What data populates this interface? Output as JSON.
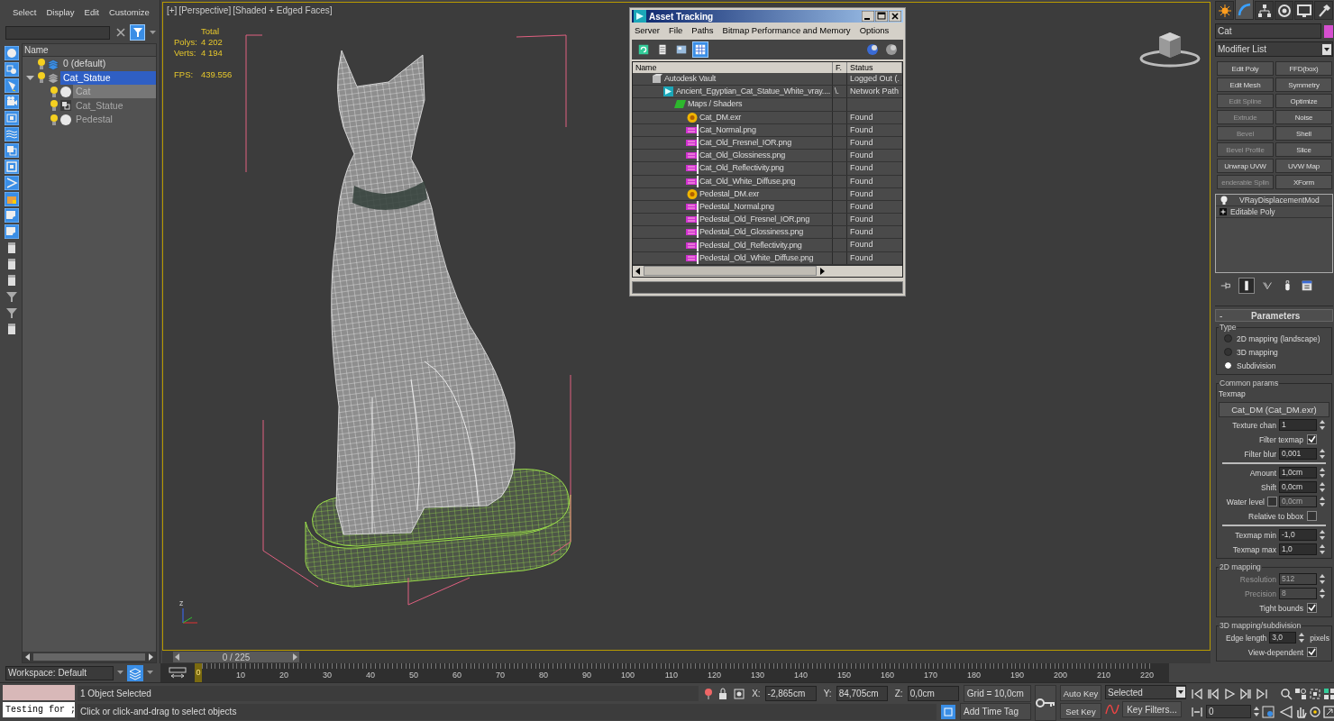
{
  "scene_explorer": {
    "menu": [
      "Select",
      "Display",
      "Edit",
      "Customize"
    ],
    "column": "Name",
    "filters": [
      {
        "kind": "sphere",
        "on": true
      },
      {
        "kind": "shapes",
        "on": true
      },
      {
        "kind": "lamp",
        "on": true
      },
      {
        "kind": "camera",
        "on": true
      },
      {
        "kind": "helper",
        "on": true
      },
      {
        "kind": "wave",
        "on": true
      },
      {
        "kind": "group",
        "on": true
      },
      {
        "kind": "frame",
        "on": true
      },
      {
        "kind": "bone",
        "on": true
      },
      {
        "kind": "container",
        "on": true
      },
      {
        "kind": "xref",
        "on": true
      },
      {
        "kind": "xref",
        "on": true
      },
      {
        "kind": "page",
        "on": false
      },
      {
        "kind": "page",
        "on": false
      },
      {
        "kind": "page",
        "on": false
      },
      {
        "kind": "funnel",
        "on": false
      },
      {
        "kind": "funnel",
        "on": false
      },
      {
        "kind": "page",
        "on": false
      }
    ],
    "tree": [
      {
        "label": "0 (default)",
        "kind": "layer",
        "current": true,
        "selected": false,
        "highlighted": false
      },
      {
        "label": "Cat_Statue",
        "kind": "layer",
        "current": false,
        "selected": true,
        "highlighted": false,
        "expanded": true,
        "children": [
          {
            "label": "Cat",
            "kind": "object",
            "selected": false,
            "highlighted": true
          },
          {
            "label": "Cat_Statue",
            "kind": "group",
            "selected": false,
            "highlighted": false
          },
          {
            "label": "Pedestal",
            "kind": "object",
            "selected": false,
            "highlighted": false
          }
        ]
      }
    ]
  },
  "workspace": "Workspace: Default",
  "viewport": {
    "labels": [
      "[+]",
      "[Perspective]",
      "[Shaded + Edged Faces]"
    ],
    "stats": {
      "header": "Total",
      "rows": [
        {
          "label": "Polys:",
          "value": "4 202"
        },
        {
          "label": "Verts:",
          "value": "4 194"
        }
      ],
      "fps_label": "FPS:",
      "fps": "439.556"
    },
    "axis_label": "z"
  },
  "timeline": {
    "slider": "0 / 225",
    "level": 0,
    "thumb": "0",
    "ticks": [
      "10",
      "20",
      "30",
      "40",
      "50",
      "60",
      "70",
      "80",
      "90",
      "100",
      "110",
      "120",
      "130",
      "140",
      "150",
      "160",
      "170",
      "180",
      "190",
      "200",
      "210",
      "220"
    ]
  },
  "asset_tracking": {
    "title": "Asset Tracking",
    "menu": [
      "Server",
      "File",
      "Paths",
      "Bitmap Performance and Memory",
      "Options"
    ],
    "tools": [
      {
        "kind": "refresh",
        "selected": false
      },
      {
        "kind": "list",
        "selected": false
      },
      {
        "kind": "thumbnails",
        "selected": false
      },
      {
        "kind": "table",
        "selected": true
      }
    ],
    "columns": [
      "Name",
      "F.",
      "Status"
    ],
    "rows": [
      {
        "name": "Autodesk Vault",
        "kind": "vault",
        "status": "Logged Out (.",
        "children": [
          {
            "name": "Ancient_Egyptian_Cat_Statue_White_vray....",
            "kind": "scene",
            "f": "\\.",
            "status": "Network Path",
            "children": [
              {
                "name": "Maps / Shaders",
                "kind": "maps",
                "children": [
                  {
                    "name": "Cat_DM.exr",
                    "kind": "exr",
                    "status": "Found"
                  },
                  {
                    "name": "Cat_Normal.png",
                    "kind": "png",
                    "status": "Found"
                  },
                  {
                    "name": "Cat_Old_Fresnel_IOR.png",
                    "kind": "png",
                    "status": "Found"
                  },
                  {
                    "name": "Cat_Old_Glossiness.png",
                    "kind": "png",
                    "status": "Found"
                  },
                  {
                    "name": "Cat_Old_Reflectivity.png",
                    "kind": "png",
                    "status": "Found"
                  },
                  {
                    "name": "Cat_Old_White_Diffuse.png",
                    "kind": "png",
                    "status": "Found"
                  },
                  {
                    "name": "Pedestal_DM.exr",
                    "kind": "exr",
                    "status": "Found"
                  },
                  {
                    "name": "Pedestal_Normal.png",
                    "kind": "png",
                    "status": "Found"
                  },
                  {
                    "name": "Pedestal_Old_Fresnel_IOR.png",
                    "kind": "png",
                    "status": "Found"
                  },
                  {
                    "name": "Pedestal_Old_Glossiness.png",
                    "kind": "png",
                    "status": "Found"
                  },
                  {
                    "name": "Pedestal_Old_Reflectivity.png",
                    "kind": "png",
                    "status": "Found"
                  },
                  {
                    "name": "Pedestal_Old_White_Diffuse.png",
                    "kind": "png",
                    "status": "Found"
                  }
                ]
              }
            ]
          }
        ]
      }
    ]
  },
  "command_panel": {
    "tabs": [
      {
        "kind": "create",
        "selected": false
      },
      {
        "kind": "modify",
        "selected": true
      },
      {
        "kind": "hierarchy",
        "selected": false
      },
      {
        "kind": "motion",
        "selected": false
      },
      {
        "kind": "display",
        "selected": false
      },
      {
        "kind": "utilities",
        "selected": false
      }
    ],
    "object_name": "Cat",
    "modifier_list": "Modifier List",
    "modifiers": [
      {
        "label": "Edit Poly",
        "disabled": false
      },
      {
        "label": "FFD(box)",
        "disabled": false
      },
      {
        "label": "Edit Mesh",
        "disabled": false
      },
      {
        "label": "Symmetry",
        "disabled": false
      },
      {
        "label": "Edit Spline",
        "disabled": true
      },
      {
        "label": "Optimize",
        "disabled": false
      },
      {
        "label": "Extrude",
        "disabled": true
      },
      {
        "label": "Noise",
        "disabled": false
      },
      {
        "label": "Bevel",
        "disabled": true
      },
      {
        "label": "Shell",
        "disabled": false
      },
      {
        "label": "Bevel Profile",
        "disabled": true
      },
      {
        "label": "Slice",
        "disabled": false
      },
      {
        "label": "Unwrap UVW",
        "disabled": false
      },
      {
        "label": "UVW Map",
        "disabled": false
      },
      {
        "label": "enderable Splin",
        "disabled": true
      },
      {
        "label": "XForm",
        "disabled": false
      }
    ],
    "stack": [
      {
        "label": "VRayDisplacementMod",
        "kind": "modifier"
      },
      {
        "label": "Editable Poly",
        "kind": "base"
      }
    ],
    "stack_tools": [
      {
        "kind": "pin",
        "selected": false
      },
      {
        "kind": "end_result",
        "selected": true
      },
      {
        "kind": "unique",
        "selected": false
      },
      {
        "kind": "remove",
        "selected": false
      },
      {
        "kind": "configure",
        "selected": false
      }
    ],
    "parameters": {
      "collapse": "-",
      "title": "Parameters",
      "type_group": {
        "title": "Type",
        "options": [
          {
            "label": "2D mapping (landscape)",
            "selected": false
          },
          {
            "label": "3D mapping",
            "selected": false
          },
          {
            "label": "Subdivision",
            "selected": true
          }
        ]
      },
      "common": {
        "title": "Common params",
        "texmap_label": "Texmap",
        "texmap": "Cat_DM (Cat_DM.exr)",
        "sections": [
          [
            {
              "kind": "spinner",
              "label": "Texture chan",
              "value": "1",
              "disabled": false
            },
            {
              "kind": "checkbox",
              "label": "Filter texmap",
              "checked": true,
              "disabled": false
            },
            {
              "kind": "spinner",
              "label": "Filter blur",
              "value": "0,001",
              "disabled": false
            }
          ],
          [
            {
              "kind": "spinner",
              "label": "Amount",
              "value": "1,0cm",
              "disabled": false
            },
            {
              "kind": "spinner",
              "label": "Shift",
              "value": "0,0cm",
              "disabled": false
            },
            {
              "kind": "check_spinner",
              "label": "Water level",
              "checked": false,
              "value": "0,0cm",
              "disabled": true
            },
            {
              "kind": "checkbox",
              "label": "Relative to bbox",
              "checked": false,
              "disabled": false
            }
          ],
          [
            {
              "kind": "spinner",
              "label": "Texmap min",
              "value": "-1,0",
              "disabled": false
            },
            {
              "kind": "spinner",
              "label": "Texmap max",
              "value": "1,0",
              "disabled": false
            }
          ]
        ]
      },
      "groups": [
        {
          "title": "2D mapping",
          "rows": [
            {
              "kind": "spinner",
              "label": "Resolution",
              "value": "512",
              "disabled": true
            },
            {
              "kind": "spinner",
              "label": "Precision",
              "value": "8",
              "disabled": true
            },
            {
              "kind": "checkbox",
              "label": "Tight bounds",
              "checked": true,
              "disabled": false
            }
          ]
        },
        {
          "title": "3D mapping/subdivision",
          "rows": [
            {
              "kind": "spinner",
              "label": "Edge length",
              "value": "3,0",
              "unit": "pixels",
              "disabled": false
            },
            {
              "kind": "checkbox",
              "label": "View-dependent",
              "checked": true,
              "disabled": false
            }
          ]
        }
      ]
    }
  },
  "status": {
    "listener_input": "Testing for ;",
    "selection": "1 Object Selected",
    "prompt": "Click or click-and-drag to select objects",
    "coords": [
      {
        "axis": "X:",
        "value": "-2,865cm"
      },
      {
        "axis": "Y:",
        "value": "84,705cm"
      },
      {
        "axis": "Z:",
        "value": "0,0cm"
      }
    ],
    "grid": "Grid = 10,0cm",
    "time_tag": "Add Time Tag",
    "auto_key": "Auto Key",
    "set_key": "Set Key",
    "key_mode": "Selected",
    "key_filters": "Key Filters...",
    "frame": "0"
  }
}
